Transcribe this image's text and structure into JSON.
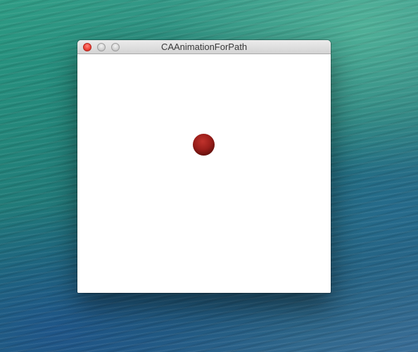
{
  "window": {
    "title": "CAAnimationForPath"
  },
  "icons": {
    "close": "close-traffic-light-icon",
    "minimize": "minimize-traffic-light-icon",
    "zoom": "zoom-traffic-light-icon"
  },
  "colors": {
    "close_button": "#f0453a",
    "ball": "#9a1e1a",
    "canvas_background": "#ffffff"
  }
}
